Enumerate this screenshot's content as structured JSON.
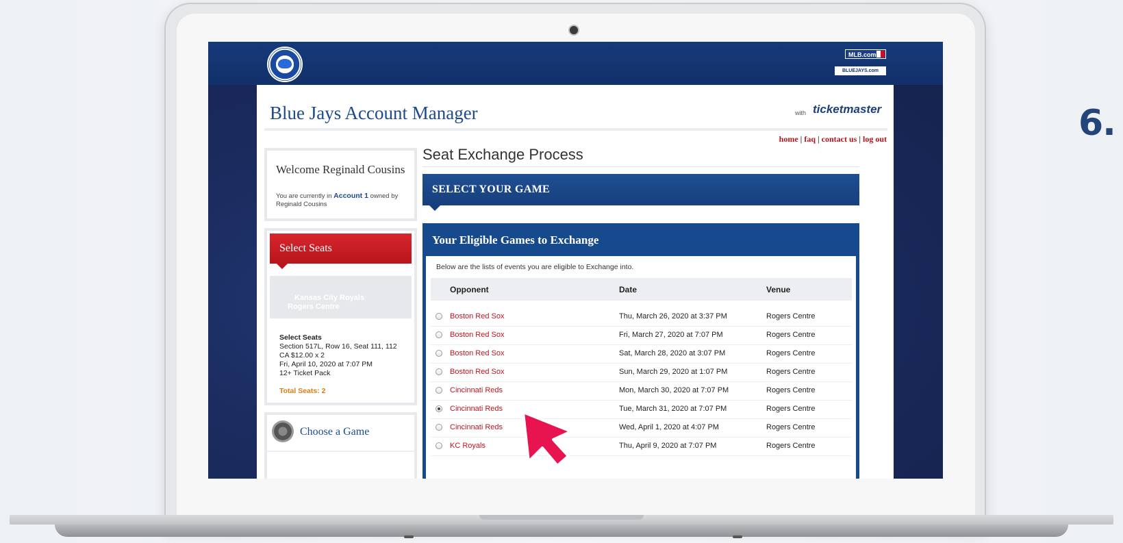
{
  "step_label": "6.",
  "header": {
    "mlb_badge": "MLB.com",
    "bluejays_badge": "BLUEJAYS.com",
    "app_title": "Blue Jays Account Manager",
    "ticketmaster_with": "with",
    "ticketmaster_logo": "ticketmaster",
    "links": [
      "home",
      "faq",
      "contact us",
      "log out"
    ]
  },
  "sidebar": {
    "welcome_name": "Welcome Reginald Cousins",
    "welcome_prefix": "You are currently in",
    "account_link": "Account 1",
    "welcome_suffix": "owned by Reginald Cousins",
    "select_seats_title": "Select Seats",
    "game_line1": "Kansas City Royals",
    "game_line2": "Rogers Centre",
    "seat_title": "Select Seats",
    "seat_section": "Section 517L, Row 16, Seat 111, 112",
    "seat_price": "CA $12.00 x 2",
    "seat_date": "Fri, April 10, 2020 at 7:07 PM",
    "seat_pack": "12+ Ticket Pack",
    "total_seats": "Total Seats: 2",
    "choose_game": "Choose a Game"
  },
  "main": {
    "page_title": "Seat Exchange Process",
    "step_bar": "SELECT YOUR GAME",
    "panel_title": "Your Eligible Games to Exchange",
    "panel_desc": "Below are the lists of events you are eligible to Exchange into.",
    "columns": [
      "Opponent",
      "Date",
      "Venue"
    ],
    "rows": [
      {
        "opponent": "Boston Red Sox",
        "date": "Thu, March 26, 2020 at 3:37 PM",
        "venue": "Rogers Centre",
        "selected": false
      },
      {
        "opponent": "Boston Red Sox",
        "date": "Fri, March 27, 2020 at 7:07 PM",
        "venue": "Rogers Centre",
        "selected": false
      },
      {
        "opponent": "Boston Red Sox",
        "date": "Sat, March 28, 2020 at 3:07 PM",
        "venue": "Rogers Centre",
        "selected": false
      },
      {
        "opponent": "Boston Red Sox",
        "date": "Sun, March 29, 2020 at 1:07 PM",
        "venue": "Rogers Centre",
        "selected": false
      },
      {
        "opponent": "Cincinnati Reds",
        "date": "Mon, March 30, 2020 at 7:07 PM",
        "venue": "Rogers Centre",
        "selected": false
      },
      {
        "opponent": "Cincinnati Reds",
        "date": "Tue, March 31, 2020 at 7:07 PM",
        "venue": "Rogers Centre",
        "selected": true
      },
      {
        "opponent": "Cincinnati Reds",
        "date": "Wed, April 1, 2020 at 4:07 PM",
        "venue": "Rogers Centre",
        "selected": false
      },
      {
        "opponent": "KC Royals",
        "date": "Thu, April 9, 2020 at 7:07 PM",
        "venue": "Rogers Centre",
        "selected": false
      }
    ]
  },
  "colors": {
    "brand_blue": "#174a8c",
    "accent_red": "#c0141d",
    "total_orange": "#e07b18",
    "cursor_pink": "#e8144f"
  }
}
